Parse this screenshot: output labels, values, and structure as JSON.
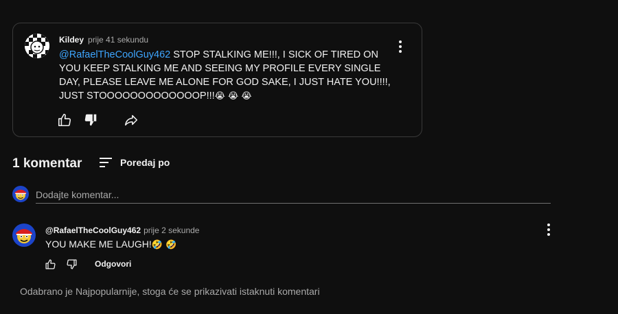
{
  "post": {
    "author": "Kildey",
    "time": "prije 41 sekundu",
    "mention": "@RafaelTheCoolGuy462",
    "text": " STOP STALKING ME!!!, I SICK OF TIRED ON YOU KEEP STALKING ME AND SEEING MY PROFILE EVERY SINGLE DAY, PLEASE LEAVE ME ALONE FOR GOD SAKE, I JUST HATE YOU!!!!, JUST STOOOOOOOOOOOOOP!!!",
    "emojis": "😭 😭 😭"
  },
  "comments_header": {
    "count_label": "1 komentar",
    "sort_label": "Poredaj po"
  },
  "add_comment": {
    "placeholder": "Dodajte komentar..."
  },
  "comment": {
    "author": "@RafaelTheCoolGuy462",
    "time": "prije 2 sekunde",
    "text": "YOU MAKE ME LAUGH!",
    "emojis": "🤣 🤣",
    "reply_label": "Odgovori"
  },
  "notice": "Odabrano je Najpopularnije, stoga će se prikazivati istaknuti komentari",
  "colors": {
    "background": "#0f0f0f",
    "mention": "#3ea6ff",
    "secondary_text": "#aaaaaa",
    "border": "#3a3a3a"
  }
}
